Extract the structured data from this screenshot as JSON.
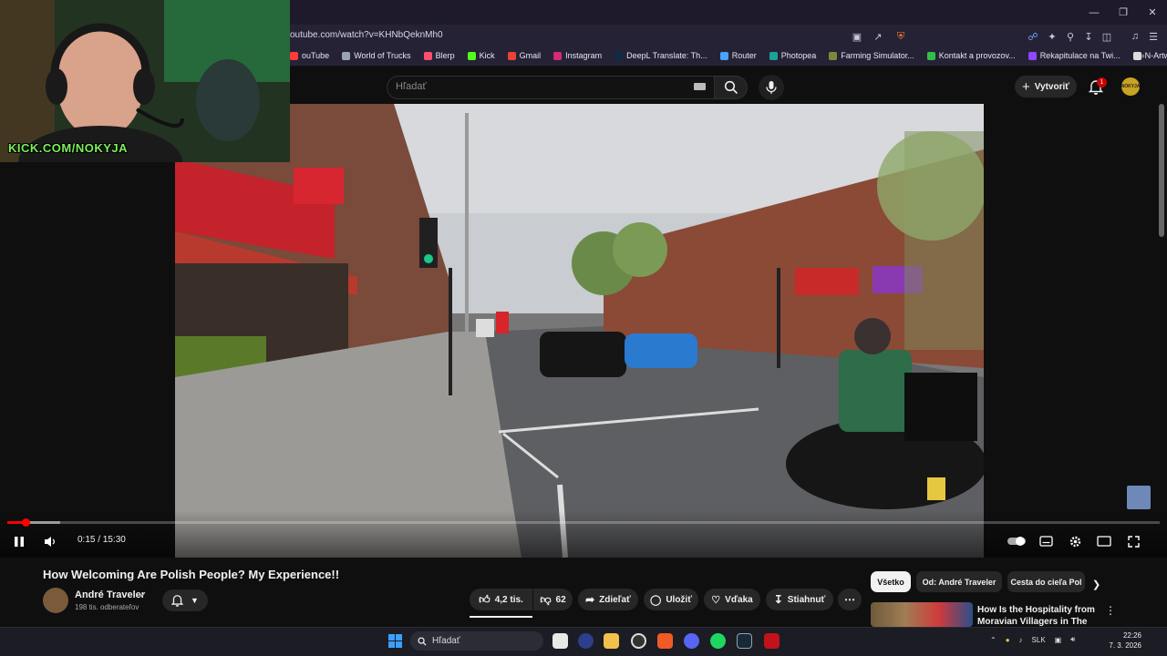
{
  "browser": {
    "url": "outube.com/watch?v=KHNbQeknMh0",
    "bookmarks": [
      {
        "label": "ouTube",
        "color": "#ff3b3b"
      },
      {
        "label": "World of Trucks",
        "color": "#9aa4b1"
      },
      {
        "label": "Blerp",
        "color": "#ff4d6d"
      },
      {
        "label": "Kick",
        "color": "#53fc18"
      },
      {
        "label": "Gmail",
        "color": "#ea4335"
      },
      {
        "label": "Instagram",
        "color": "#d62976"
      },
      {
        "label": "DeepL Translate: Th...",
        "color": "#0f2b46"
      },
      {
        "label": "Router",
        "color": "#4aa3ff"
      },
      {
        "label": "Photopea",
        "color": "#18a497"
      },
      {
        "label": "Farming Simulator...",
        "color": "#7a8a3a"
      },
      {
        "label": "Kontakt a provozov...",
        "color": "#2fbf4a"
      },
      {
        "label": "Rekapitulace na Twi...",
        "color": "#9146ff"
      },
      {
        "label": "N-Artworks - PNG",
        "color": "#dddddd"
      }
    ]
  },
  "header": {
    "search_placeholder": "Hľadať",
    "create_label": "Vytvoriť",
    "notification_count": "1",
    "avatar_text": "NOKYJA"
  },
  "webcam": {
    "label": "KICK.COM/NOKYJA"
  },
  "player": {
    "time": "0:15 / 15:30",
    "progress": 0.016
  },
  "video": {
    "title": "How Welcoming Are Polish People? My Experience!!",
    "channel": "André Traveler",
    "subscribers": "198 tis. odberateľov",
    "likes": "4,2 tis.",
    "dislikes": "62",
    "share_label": "Zdieľať",
    "save_label": "Uložiť",
    "thanks_label": "Vďaka",
    "download_label": "Stiahnuť"
  },
  "chips": [
    "Všetko",
    "Od: André Traveler",
    "Cesta do cieľa Pol"
  ],
  "recommendation": {
    "title": "How Is the Hospitality from Moravian Villagers in The Cze..."
  },
  "taskbar": {
    "search_label": "Hľadať",
    "language": "SLK",
    "time": "22:26",
    "date": "7. 3. 2026"
  },
  "colors": {
    "accent_red": "#ff0000",
    "kick_green": "#7bf05a"
  }
}
